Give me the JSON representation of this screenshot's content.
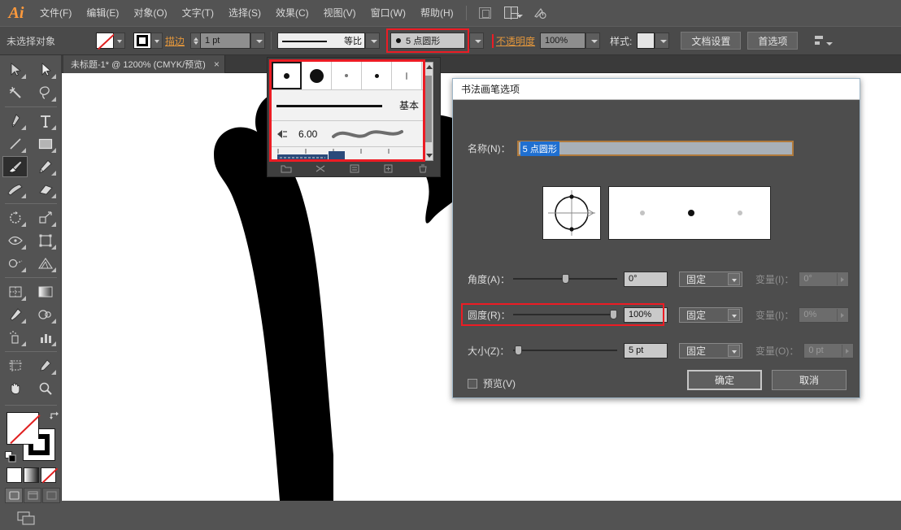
{
  "app": {
    "logo": "Ai"
  },
  "menubar": {
    "items": [
      {
        "label": "文件(F)"
      },
      {
        "label": "编辑(E)"
      },
      {
        "label": "对象(O)"
      },
      {
        "label": "文字(T)"
      },
      {
        "label": "选择(S)"
      },
      {
        "label": "效果(C)"
      },
      {
        "label": "视图(V)"
      },
      {
        "label": "窗口(W)"
      },
      {
        "label": "帮助(H)"
      }
    ],
    "icons": [
      "artboard-icon",
      "arrange-documents-icon",
      "bridge-icon"
    ]
  },
  "controlbar": {
    "selection_status": "未选择对象",
    "fill_swatch": "none",
    "stroke_swatch": "black",
    "stroke_label": "描边",
    "stroke_width": "1 pt",
    "profile_label": "等比",
    "brush_label": "5 点圆形",
    "opacity_label": "不透明度",
    "opacity_value": "100%",
    "style_label": "样式:",
    "doc_setup_button": "文档设置",
    "preferences_button": "首选项",
    "highlight_color": "#ec1c24",
    "accent_color": "#e2963c"
  },
  "document_tab": {
    "title": "未标题-1* @ 1200% (CMYK/预览)",
    "close": "×"
  },
  "toolbar": {
    "tools": [
      {
        "name": "selection-tool"
      },
      {
        "name": "direct-selection-tool"
      },
      {
        "name": "magic-wand-tool"
      },
      {
        "name": "lasso-tool"
      },
      {
        "name": "pen-tool"
      },
      {
        "name": "type-tool"
      },
      {
        "name": "line-segment-tool"
      },
      {
        "name": "rectangle-tool"
      },
      {
        "name": "paintbrush-tool",
        "active": true
      },
      {
        "name": "pencil-tool"
      },
      {
        "name": "blob-brush-tool"
      },
      {
        "name": "eraser-tool"
      },
      {
        "name": "rotate-tool"
      },
      {
        "name": "scale-tool"
      },
      {
        "name": "width-tool"
      },
      {
        "name": "free-transform-tool"
      },
      {
        "name": "shape-builder-tool"
      },
      {
        "name": "perspective-grid-tool"
      },
      {
        "name": "mesh-tool"
      },
      {
        "name": "gradient-tool"
      },
      {
        "name": "eyedropper-tool"
      },
      {
        "name": "blend-tool"
      },
      {
        "name": "symbol-sprayer-tool"
      },
      {
        "name": "column-graph-tool"
      },
      {
        "name": "artboard-tool"
      },
      {
        "name": "slice-tool"
      },
      {
        "name": "hand-tool"
      },
      {
        "name": "zoom-tool"
      }
    ],
    "fill_stroke": {
      "fill": "none",
      "stroke": "#000000"
    },
    "color_modes": [
      "color-mode",
      "gradient-mode",
      "none-mode"
    ],
    "screen_modes": [
      "normal-screen-mode",
      "full-screen-menu-mode",
      "full-screen-mode"
    ],
    "panel_toggle": "change-screen-mode"
  },
  "brush_panel": {
    "thumbs": [
      {
        "name": "brush-5pt-round",
        "selected": true,
        "size": 7
      },
      {
        "name": "brush-large-round",
        "selected": false,
        "size": 17
      },
      {
        "name": "brush-small-1",
        "selected": false,
        "size": 4
      },
      {
        "name": "brush-small-2",
        "selected": false,
        "size": 5
      },
      {
        "name": "brush-thin",
        "selected": false,
        "size": 2
      }
    ],
    "basic_label": "基本",
    "calligraphic_value": "6.00",
    "highlight_color": "#ec1c24"
  },
  "dialog": {
    "title": "书法画笔选项",
    "name_label": "名称(N)：",
    "name_value": "5 点圆形",
    "rows": [
      {
        "label": "角度(A)：",
        "value": "0°",
        "slider_pct": 48,
        "mode": "固定",
        "variation_label": "变量(I)：",
        "variation_value": "0°"
      },
      {
        "label": "圆度(R)：",
        "value": "100%",
        "slider_pct": 98,
        "mode": "固定",
        "variation_label": "变量(I)：",
        "variation_value": "0%",
        "highlighted": true
      },
      {
        "label": "大小(Z)：",
        "value": "5 pt",
        "slider_pct": 3,
        "mode": "固定",
        "variation_label": "变量(O)：",
        "variation_value": "0 pt"
      }
    ],
    "preview_checkbox": "预览(V)",
    "ok_button": "确定",
    "cancel_button": "取消",
    "highlight_color": "#ec1c24"
  }
}
